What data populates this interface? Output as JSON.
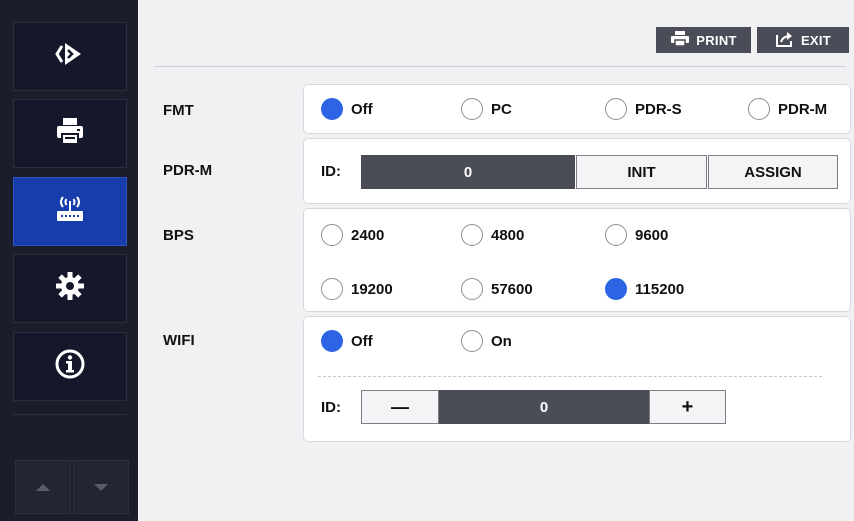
{
  "sidebar": {
    "items": [
      {
        "icon": "brand-logo-icon",
        "active": false
      },
      {
        "icon": "printer-icon",
        "active": false
      },
      {
        "icon": "wireless-router-icon",
        "active": true
      },
      {
        "icon": "gear-icon",
        "active": false
      },
      {
        "icon": "info-icon",
        "active": false
      }
    ],
    "nav": {
      "up_icon": "arrow-up-icon",
      "down_icon": "arrow-down-icon"
    }
  },
  "toolbar": {
    "print_label": "PRINT",
    "exit_label": "EXIT"
  },
  "fmt": {
    "label": "FMT",
    "options": [
      "Off",
      "PC",
      "PDR-S",
      "PDR-M"
    ],
    "selected": "Off"
  },
  "pdrm": {
    "label": "PDR-M",
    "id_label": "ID:",
    "id_value": "0",
    "init_label": "INIT",
    "assign_label": "ASSIGN"
  },
  "bps": {
    "label": "BPS",
    "options": [
      "2400",
      "4800",
      "9600",
      "19200",
      "57600",
      "115200"
    ],
    "selected": "115200"
  },
  "wifi": {
    "label": "WIFI",
    "options": [
      "Off",
      "On"
    ],
    "selected": "Off",
    "id_label": "ID:",
    "id_value": "0",
    "minus": "—",
    "plus": "+"
  },
  "colors": {
    "accent": "#2d64e3",
    "sidebar": "#1c1d2b",
    "active_nav": "#163dab",
    "dark_field": "#4a4c56"
  }
}
